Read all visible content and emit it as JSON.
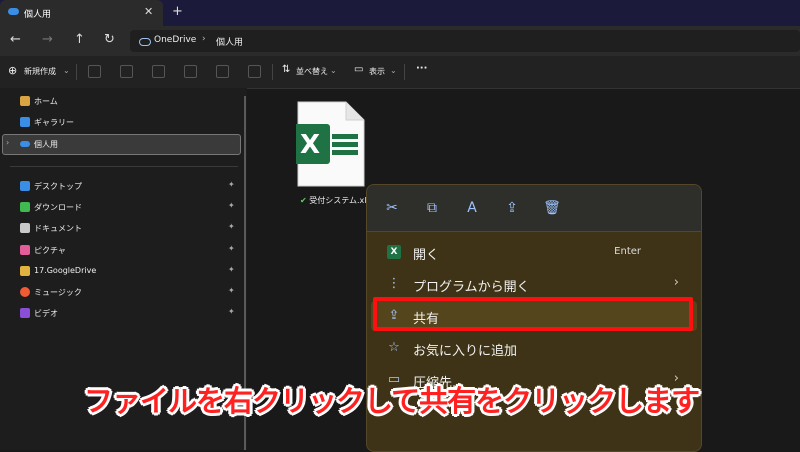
{
  "tab": {
    "title": "個人用",
    "close": "✕",
    "new_tab": "+"
  },
  "nav": {
    "back": "←",
    "forward": "→",
    "up": "↑",
    "refresh": "↻"
  },
  "address": {
    "root": "OneDrive",
    "separator": "›",
    "folder": "個人用"
  },
  "toolbar": {
    "new_label": "新規作成",
    "sort_label": "並べ替え",
    "view_label": "表示",
    "more_label": "···"
  },
  "sidebar": {
    "items": [
      {
        "label": "ホーム",
        "color": "#d9a441"
      },
      {
        "label": "ギャラリー",
        "color": "#3a8ee6"
      },
      {
        "label": "個人用",
        "color": "#3a8ee6"
      },
      {
        "label": "デスクトップ",
        "color": "#3a8ee6"
      },
      {
        "label": "ダウンロード",
        "color": "#3fb950"
      },
      {
        "label": "ドキュメント",
        "color": "#c9c9c9"
      },
      {
        "label": "ピクチャ",
        "color": "#e35d9a"
      },
      {
        "label": "17.GoogleDrive",
        "color": "#e3b341"
      },
      {
        "label": "ミュージック",
        "color": "#f05b36"
      },
      {
        "label": "ビデオ",
        "color": "#8a4fd6"
      }
    ],
    "pin_glyph": "📌"
  },
  "file": {
    "name": "受付システム.xlsx",
    "badge": "X"
  },
  "context_menu": {
    "icons": [
      "cut-icon",
      "copy-icon",
      "rename-icon",
      "share-icon",
      "delete-icon"
    ],
    "items": [
      {
        "label": "開く",
        "accelerator": "Enter"
      },
      {
        "label": "プログラムから開く",
        "submenu": "›"
      },
      {
        "label": "共有"
      },
      {
        "label": "お気に入りに追加"
      },
      {
        "label": "圧縮先...",
        "submenu": "›"
      }
    ]
  },
  "caption": "ファイルを右クリックして共有をクリックします",
  "colors": {
    "highlight": "#ff1010",
    "caption": "#ff2020",
    "excel_green": "#1f7244"
  }
}
